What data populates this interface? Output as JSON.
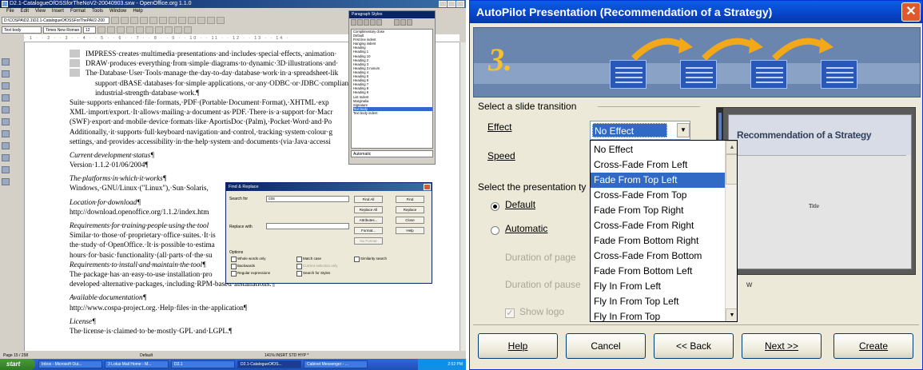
{
  "writer": {
    "title": "D2.1-CatalogueOfOSSforTheNoV2-20040903.sxw - OpenOffice.org 1.1.0",
    "menu": [
      "File",
      "Edit",
      "View",
      "Insert",
      "Format",
      "Tools",
      "Window",
      "Help"
    ],
    "path": "D:\\COSPA\\D2.1\\D2.1-CatalogueOfOSSForThePAV2-200",
    "style_box": "Text body",
    "font_box": "Times New Roman",
    "size_box": "12",
    "ruler": "· 1 · · 2 · · 3 · · 4 · · 5 · · 6 · · 7 · · 8 · · 9 · · 10 · · 11 · · 12 · · 13 · · 14 ·",
    "document_lines": [
      {
        "kind": "bul",
        "text": "IMPRESS·creates·multimedia·presentations·and·includes·special·effects,·animation·"
      },
      {
        "kind": "bul",
        "text": "DRAW·produces·everything·from·simple·diagrams·to·dynamic·3D·illustrations·and·"
      },
      {
        "kind": "bul",
        "text": "The·Database·User·Tools·manage·the·day-to-day·database·work·in·a·spreadsheet-lik"
      },
      {
        "kind": "cont",
        "text": "support·dBASE·databases·for·simple·applications,·or·any·ODBC·or·JDBC·complian"
      },
      {
        "kind": "cont",
        "text": "industrial-strength·database·work.¶"
      },
      {
        "kind": "plain",
        "text": "Suite·supports·enhanced·file·formats,·PDF·(Portable·Document·Format),·XHTML·exp"
      },
      {
        "kind": "plain",
        "text": "XML·import/export.·It·allows·mailing·a·document·as·PDF.·There·is·a·support·for·Macr"
      },
      {
        "kind": "plain",
        "text": "(SWF)·export·and·mobile·device·formats·like·AportisDoc·(Palm),·Pocket·Word·and·Po"
      },
      {
        "kind": "plain",
        "text": "Additionally,·it·supports·full·keyboard·navigation·and·control,·tracking·system·colour·g"
      },
      {
        "kind": "plain",
        "text": "settings,·and·provides·accessibility·in·the·help·system·and·documents·(via·Java·accessi"
      },
      {
        "kind": "gap",
        "text": ""
      },
      {
        "kind": "it",
        "text": "Current·development·status¶"
      },
      {
        "kind": "plain",
        "text": "Version·1.1.2·01/06/2004¶"
      },
      {
        "kind": "gap",
        "text": ""
      },
      {
        "kind": "it",
        "text": "The·platforms·in·which·it·works¶"
      },
      {
        "kind": "plain",
        "text": "Windows,·GNU/Linux·(\"Linux\"),·Sun·Solaris,"
      },
      {
        "kind": "gap",
        "text": ""
      },
      {
        "kind": "it",
        "text": "Location·for·download¶"
      },
      {
        "kind": "plain",
        "text": "http://download.openoffice.org/1.1.2/index.htm"
      },
      {
        "kind": "gap",
        "text": ""
      },
      {
        "kind": "it",
        "text": "Requirements·for·training·people·using·the·tool"
      },
      {
        "kind": "plain",
        "text": "Similar·to·those·of·proprietary·office·suites.·It·is"
      },
      {
        "kind": "plain",
        "text": "the·study·of·OpenOffice.·It·is·possible·to·estima"
      },
      {
        "kind": "plain",
        "text": "hours·for·basic·functionality·(all·parts·of·the·su"
      },
      {
        "kind": "it",
        "text": "Requirements·to·install·and·maintain·the·tool¶"
      },
      {
        "kind": "plain",
        "text": "The·package·has·an·easy-to-use·installation·pro"
      },
      {
        "kind": "plain",
        "text": "developed·alternative·packages,·including·RPM-based·installations.¶"
      },
      {
        "kind": "gap",
        "text": ""
      },
      {
        "kind": "it",
        "text": "Available·documentation¶"
      },
      {
        "kind": "plain",
        "text": "http://www.cospa-project.org.·Help·files·in·the·application¶"
      },
      {
        "kind": "gap",
        "text": ""
      },
      {
        "kind": "it",
        "text": "License¶"
      },
      {
        "kind": "plain",
        "text": "The·license·is·claimed·to·be·mostly·GPL·and·LGPL.¶"
      }
    ],
    "status_page": "Page 15 / 258",
    "status_style": "Default",
    "status_right": "141% INSRT STD HYP *",
    "taskbar": {
      "start": "start",
      "tasks": [
        "Inbox - Microsoft Out...",
        "3 Lotus Mail Home - M...",
        "D2.1",
        "D2.1-CatalogueOfOS...",
        "Cabinet Messenger - ..."
      ],
      "clock": "2:52 PM"
    },
    "paragraph_styles": {
      "title": "Paragraph Styles",
      "items": [
        "Complimentary close",
        "Default",
        "First line indent",
        "Hanging indent",
        "Heading",
        "Heading 1",
        "Heading 10",
        "Heading 2",
        "Heading 3",
        "Heading 3 nonum",
        "Heading 4",
        "Heading 5",
        "Heading 6",
        "Heading 7",
        "Heading 8",
        "Heading 9",
        "List Indent",
        "Marginalia",
        "Signature",
        "Text body",
        "Text body indent"
      ],
      "selected": "Text body",
      "filter": "Automatic"
    },
    "find_replace": {
      "title": "Find & Replace",
      "search_label": "Search for",
      "search_value": "cos",
      "replace_label": "Replace with",
      "replace_value": "",
      "buttons_right": [
        "Find All",
        "Replace All",
        "Attributes...",
        "Format...",
        "No Format"
      ],
      "buttons_far": [
        "Find",
        "Replace",
        "Close",
        "Help"
      ],
      "options_label": "Options",
      "options": [
        "Whole words only",
        "Backwards",
        "Regular expressions",
        "Match case",
        "Current selection only",
        "Search for Styles",
        "Similarity search"
      ]
    }
  },
  "autopilot": {
    "title": "AutoPilot Presentation (Recommendation of a Strategy)",
    "step_number": "3.",
    "section_transition": "Select a slide transition",
    "effect_label": "Effect",
    "effect_value": "No Effect",
    "speed_label": "Speed",
    "section_type": "Select the presentation ty",
    "radio_default": "Default",
    "radio_automatic": "Automatic",
    "duration_page": "Duration of page",
    "duration_pause": "Duration of pause",
    "show_logo": "Show logo",
    "selected_radio": "Default",
    "effect_options": [
      "No Effect",
      "Cross-Fade From Left",
      "Fade From Top Left",
      "Cross-Fade From Top",
      "Fade From Top Right",
      "Cross-Fade From Right",
      "Fade From Bottom Right",
      "Cross-Fade From Bottom",
      "Fade From Bottom Left",
      "Fly In From Left",
      "Fly In From Top Left",
      "Fly In From Top"
    ],
    "highlighted_option": "Fade From Top Left",
    "preview": {
      "title": "Recommendation of a Strategy",
      "subtitle": "Title",
      "partial_text": "w"
    },
    "buttons": {
      "help": "Help",
      "cancel": "Cancel",
      "back": "<< Back",
      "next": "Next >>",
      "create": "Create"
    },
    "colors": {
      "titlebar": "#0a5fe6",
      "selection": "#316ac5",
      "step_number": "#f5c12e",
      "dialog_bg": "#ece9d8"
    }
  }
}
